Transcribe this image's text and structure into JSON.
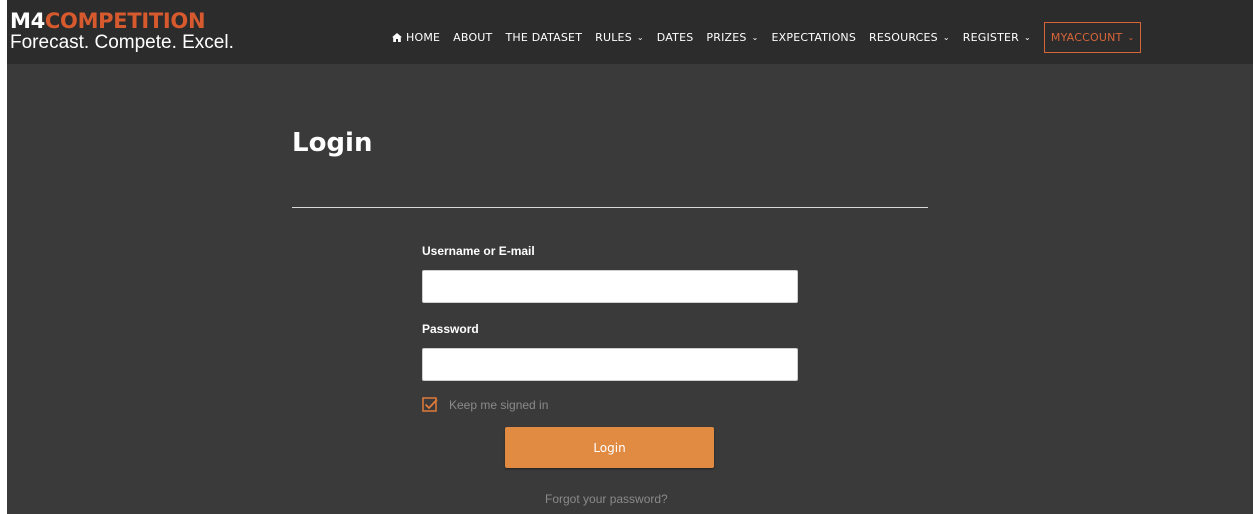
{
  "brand": {
    "logo_prefix": "M4",
    "logo_suffix": "COMPETITION",
    "tagline": "Forecast. Compete. Excel."
  },
  "nav": {
    "home_label": "HOME",
    "items": [
      {
        "label": "ABOUT",
        "has_dropdown": false
      },
      {
        "label": "THE DATASET",
        "has_dropdown": false
      },
      {
        "label": "RULES",
        "has_dropdown": true
      },
      {
        "label": "DATES",
        "has_dropdown": false
      },
      {
        "label": "PRIZES",
        "has_dropdown": true
      },
      {
        "label": "EXPECTATIONS",
        "has_dropdown": false
      },
      {
        "label": "RESOURCES",
        "has_dropdown": true
      },
      {
        "label": "REGISTER",
        "has_dropdown": true
      }
    ],
    "account_label": "MYACCOUNT"
  },
  "login": {
    "title": "Login",
    "username_label": "Username or E-mail",
    "username_value": "",
    "password_label": "Password",
    "password_value": "",
    "remember_label": "Keep me signed in",
    "remember_checked": true,
    "submit_label": "Login",
    "forgot_label": "Forgot your password?"
  },
  "colors": {
    "background": "#3a3a3a",
    "header": "#2c2c2c",
    "accent": "#d65a2e",
    "button": "#e08a42"
  },
  "icons": {
    "home": "home-icon",
    "chevron": "chevron-down-icon",
    "checkbox": "checkbox-checked-icon"
  }
}
